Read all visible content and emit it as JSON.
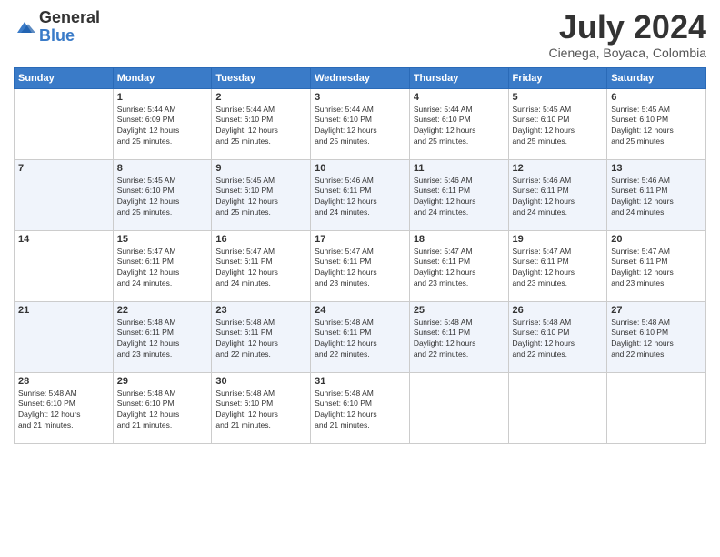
{
  "header": {
    "logo_general": "General",
    "logo_blue": "Blue",
    "month_title": "July 2024",
    "location": "Cienega, Boyaca, Colombia"
  },
  "days_of_week": [
    "Sunday",
    "Monday",
    "Tuesday",
    "Wednesday",
    "Thursday",
    "Friday",
    "Saturday"
  ],
  "weeks": [
    [
      {
        "day": "",
        "info": ""
      },
      {
        "day": "1",
        "info": "Sunrise: 5:44 AM\nSunset: 6:09 PM\nDaylight: 12 hours\nand 25 minutes."
      },
      {
        "day": "2",
        "info": "Sunrise: 5:44 AM\nSunset: 6:10 PM\nDaylight: 12 hours\nand 25 minutes."
      },
      {
        "day": "3",
        "info": "Sunrise: 5:44 AM\nSunset: 6:10 PM\nDaylight: 12 hours\nand 25 minutes."
      },
      {
        "day": "4",
        "info": "Sunrise: 5:44 AM\nSunset: 6:10 PM\nDaylight: 12 hours\nand 25 minutes."
      },
      {
        "day": "5",
        "info": "Sunrise: 5:45 AM\nSunset: 6:10 PM\nDaylight: 12 hours\nand 25 minutes."
      },
      {
        "day": "6",
        "info": "Sunrise: 5:45 AM\nSunset: 6:10 PM\nDaylight: 12 hours\nand 25 minutes."
      }
    ],
    [
      {
        "day": "7",
        "info": ""
      },
      {
        "day": "8",
        "info": "Sunrise: 5:45 AM\nSunset: 6:10 PM\nDaylight: 12 hours\nand 25 minutes."
      },
      {
        "day": "9",
        "info": "Sunrise: 5:45 AM\nSunset: 6:10 PM\nDaylight: 12 hours\nand 25 minutes."
      },
      {
        "day": "10",
        "info": "Sunrise: 5:46 AM\nSunset: 6:11 PM\nDaylight: 12 hours\nand 24 minutes."
      },
      {
        "day": "11",
        "info": "Sunrise: 5:46 AM\nSunset: 6:11 PM\nDaylight: 12 hours\nand 24 minutes."
      },
      {
        "day": "12",
        "info": "Sunrise: 5:46 AM\nSunset: 6:11 PM\nDaylight: 12 hours\nand 24 minutes."
      },
      {
        "day": "13",
        "info": "Sunrise: 5:46 AM\nSunset: 6:11 PM\nDaylight: 12 hours\nand 24 minutes."
      }
    ],
    [
      {
        "day": "14",
        "info": ""
      },
      {
        "day": "15",
        "info": "Sunrise: 5:47 AM\nSunset: 6:11 PM\nDaylight: 12 hours\nand 24 minutes."
      },
      {
        "day": "16",
        "info": "Sunrise: 5:47 AM\nSunset: 6:11 PM\nDaylight: 12 hours\nand 24 minutes."
      },
      {
        "day": "17",
        "info": "Sunrise: 5:47 AM\nSunset: 6:11 PM\nDaylight: 12 hours\nand 23 minutes."
      },
      {
        "day": "18",
        "info": "Sunrise: 5:47 AM\nSunset: 6:11 PM\nDaylight: 12 hours\nand 23 minutes."
      },
      {
        "day": "19",
        "info": "Sunrise: 5:47 AM\nSunset: 6:11 PM\nDaylight: 12 hours\nand 23 minutes."
      },
      {
        "day": "20",
        "info": "Sunrise: 5:47 AM\nSunset: 6:11 PM\nDaylight: 12 hours\nand 23 minutes."
      }
    ],
    [
      {
        "day": "21",
        "info": ""
      },
      {
        "day": "22",
        "info": "Sunrise: 5:48 AM\nSunset: 6:11 PM\nDaylight: 12 hours\nand 23 minutes."
      },
      {
        "day": "23",
        "info": "Sunrise: 5:48 AM\nSunset: 6:11 PM\nDaylight: 12 hours\nand 22 minutes."
      },
      {
        "day": "24",
        "info": "Sunrise: 5:48 AM\nSunset: 6:11 PM\nDaylight: 12 hours\nand 22 minutes."
      },
      {
        "day": "25",
        "info": "Sunrise: 5:48 AM\nSunset: 6:11 PM\nDaylight: 12 hours\nand 22 minutes."
      },
      {
        "day": "26",
        "info": "Sunrise: 5:48 AM\nSunset: 6:10 PM\nDaylight: 12 hours\nand 22 minutes."
      },
      {
        "day": "27",
        "info": "Sunrise: 5:48 AM\nSunset: 6:10 PM\nDaylight: 12 hours\nand 22 minutes."
      }
    ],
    [
      {
        "day": "28",
        "info": "Sunrise: 5:48 AM\nSunset: 6:10 PM\nDaylight: 12 hours\nand 21 minutes."
      },
      {
        "day": "29",
        "info": "Sunrise: 5:48 AM\nSunset: 6:10 PM\nDaylight: 12 hours\nand 21 minutes."
      },
      {
        "day": "30",
        "info": "Sunrise: 5:48 AM\nSunset: 6:10 PM\nDaylight: 12 hours\nand 21 minutes."
      },
      {
        "day": "31",
        "info": "Sunrise: 5:48 AM\nSunset: 6:10 PM\nDaylight: 12 hours\nand 21 minutes."
      },
      {
        "day": "",
        "info": ""
      },
      {
        "day": "",
        "info": ""
      },
      {
        "day": "",
        "info": ""
      }
    ]
  ]
}
